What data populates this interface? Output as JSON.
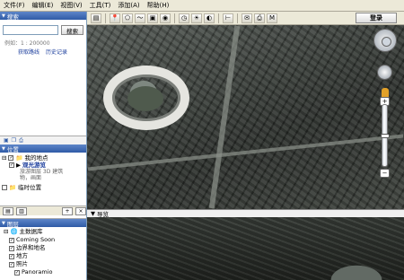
{
  "menu": {
    "items": [
      "文件(F)",
      "编辑(E)",
      "视图(V)",
      "工具(T)",
      "添加(A)",
      "帮助(H)"
    ]
  },
  "toolbar": {
    "login_label": "登录"
  },
  "search_panel": {
    "title": "搜索",
    "input_value": "",
    "search_button": "搜索",
    "example_text": "例如：1 : 200000",
    "link_directions": "获取路线",
    "link_history": "历史记录"
  },
  "places_panel": {
    "title": "位置",
    "items": [
      {
        "label": "我的地点",
        "checked": true
      },
      {
        "label": "观光游览",
        "checked": true,
        "desc": "旅游图层 3D 建筑物，画面"
      },
      {
        "label": "临时位置",
        "checked": false
      }
    ]
  },
  "layers_panel": {
    "title": "图层",
    "items": [
      {
        "label": "主数据库",
        "checked": true
      },
      {
        "label": "Coming Soon",
        "checked": true
      },
      {
        "label": "边界和地名",
        "checked": true
      },
      {
        "label": "地方",
        "checked": true
      },
      {
        "label": "照片",
        "checked": true
      },
      {
        "label": "Panoramio",
        "checked": true
      }
    ]
  },
  "navigation": {
    "label": "导览"
  }
}
